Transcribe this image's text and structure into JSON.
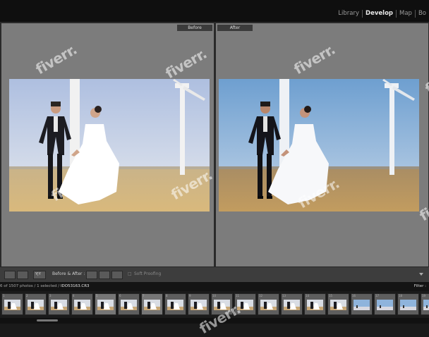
{
  "modules": [
    {
      "label": "Library",
      "active": false
    },
    {
      "label": "Develop",
      "active": true
    },
    {
      "label": "Map",
      "active": false
    },
    {
      "label": "Bo",
      "active": false
    }
  ],
  "panes": {
    "before_label": "Before",
    "after_label": "After"
  },
  "toolbar": {
    "view_mode_label": "Y|Y",
    "before_after_label": "Before & After :",
    "soft_proofing_label": "Soft Proofing"
  },
  "filmbar": {
    "status_prefix": "6 of 1507 photos / 1 selected /",
    "filename": "IDO53163.CR3",
    "filter_label": "Filter :"
  },
  "watermark": "fiverr.",
  "colors": {
    "sky_before": "#c7d2e6",
    "sky_after": "#8fb1d6",
    "field_before": "#d7ba86",
    "field_after": "#b99762",
    "pane_bg": "#7c7c7c"
  },
  "filmstrip_cells": [
    {
      "num": "1",
      "kind": "couple"
    },
    {
      "num": "2",
      "kind": "couple"
    },
    {
      "num": "3",
      "kind": "couple"
    },
    {
      "num": "4",
      "kind": "couple"
    },
    {
      "num": "5",
      "kind": "couple"
    },
    {
      "num": "6",
      "kind": "couple"
    },
    {
      "num": "7",
      "kind": "couple"
    },
    {
      "num": "8",
      "kind": "couple"
    },
    {
      "num": "9",
      "kind": "couple"
    },
    {
      "num": "10",
      "kind": "couple"
    },
    {
      "num": "11",
      "kind": "couple"
    },
    {
      "num": "12",
      "kind": "couple"
    },
    {
      "num": "13",
      "kind": "couple"
    },
    {
      "num": "14",
      "kind": "couple"
    },
    {
      "num": "15",
      "kind": "couple"
    },
    {
      "num": "16",
      "kind": "sky"
    },
    {
      "num": "17",
      "kind": "sky"
    },
    {
      "num": "18",
      "kind": "sky"
    },
    {
      "num": "19",
      "kind": "sky"
    }
  ]
}
